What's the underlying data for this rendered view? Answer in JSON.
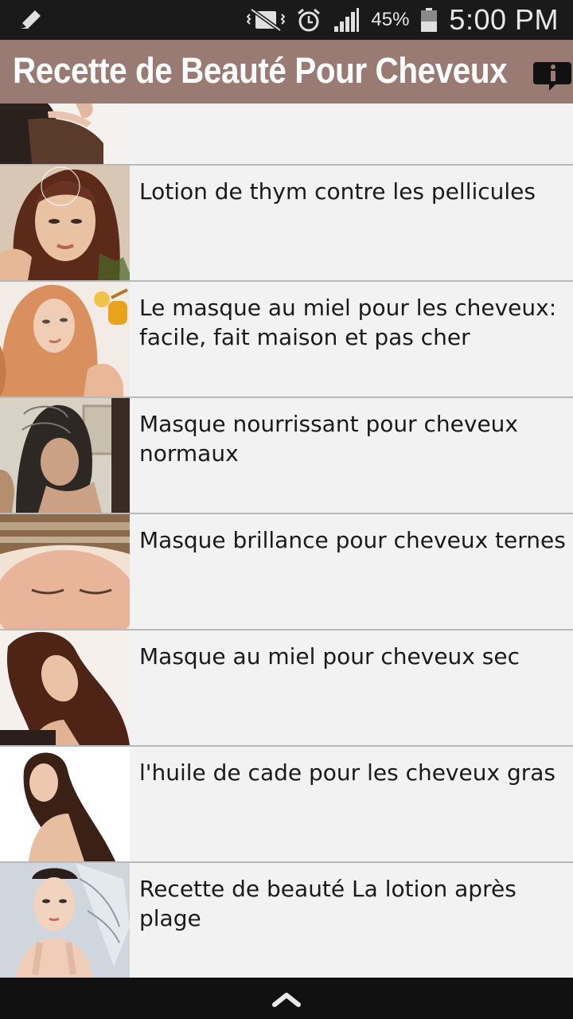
{
  "status": {
    "battery_percent": "45%",
    "time": "5:00 PM",
    "icons": [
      "pencil-icon",
      "vibrate-mute-icon",
      "alarm-icon",
      "signal-icon",
      "battery-icon"
    ]
  },
  "header": {
    "title": "Recette de Beauté Pour Cheveux",
    "info_icon": "info-icon",
    "color": "#9a7b73"
  },
  "list": {
    "items": [
      {
        "label": ""
      },
      {
        "label": "Lotion de thym contre les pellicules"
      },
      {
        "label": "Le masque au miel pour les cheveux: facile, fait maison et pas cher"
      },
      {
        "label": "Masque nourrissant pour cheveux normaux"
      },
      {
        "label": "Masque brillance pour cheveux ternes"
      },
      {
        "label": "Masque au miel pour cheveux sec"
      },
      {
        "label": "l'huile de cade pour les cheveux gras"
      },
      {
        "label": "Recette de beauté La lotion après plage"
      }
    ]
  },
  "bottom_nav": {
    "icon": "chevron-up-icon"
  }
}
